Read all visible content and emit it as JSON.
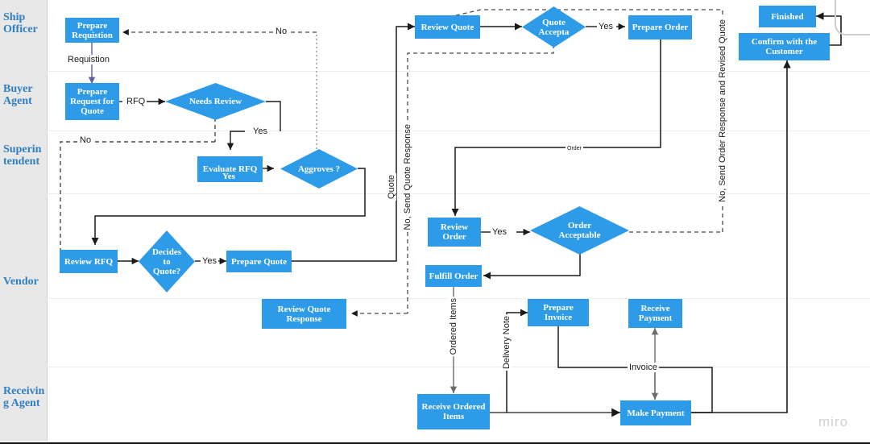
{
  "board": {
    "watermark": "miro"
  },
  "lanes": [
    {
      "id": "ship-officer",
      "label": "Ship Officer"
    },
    {
      "id": "buyer-agent",
      "label": "Buyer Agent"
    },
    {
      "id": "superintendent",
      "label": "Superintendent"
    },
    {
      "id": "vendor",
      "label": "Vendor"
    },
    {
      "id": "receiving-agent",
      "label": "Receiving Agent"
    }
  ],
  "nodes": [
    {
      "id": "prepare-requisition",
      "label": "Prepare Requistion",
      "shape": "box"
    },
    {
      "id": "prepare-request-quote",
      "label": "Prepare Request for Quote",
      "shape": "box"
    },
    {
      "id": "needs-review",
      "label": "Needs Review",
      "shape": "diamond"
    },
    {
      "id": "evaluate-rfq",
      "label": "Evaluate RFQ",
      "shape": "box"
    },
    {
      "id": "approves",
      "label": "Aggroves ?",
      "shape": "diamond"
    },
    {
      "id": "review-rfq",
      "label": "Review RFQ",
      "shape": "box"
    },
    {
      "id": "decides-to-quote",
      "label": "Decides to Quote?",
      "shape": "diamond"
    },
    {
      "id": "prepare-quote",
      "label": "Prepare Quote",
      "shape": "box"
    },
    {
      "id": "review-quote-response",
      "label": "Review Quote Response",
      "shape": "box"
    },
    {
      "id": "review-quote",
      "label": "Review Quote",
      "shape": "box"
    },
    {
      "id": "quote-accepted",
      "label": "Quote Accepta",
      "shape": "diamond"
    },
    {
      "id": "prepare-order",
      "label": "Prepare Order",
      "shape": "box"
    },
    {
      "id": "review-order",
      "label": "Review Order",
      "shape": "box"
    },
    {
      "id": "order-acceptable",
      "label": "Order Acceptable",
      "shape": "diamond"
    },
    {
      "id": "fulfill-order",
      "label": "Fulfill Order",
      "shape": "box"
    },
    {
      "id": "receive-ordered-items",
      "label": "Receive Ordered Items",
      "shape": "box"
    },
    {
      "id": "prepare-invoice",
      "label": "Prepare Invoice",
      "shape": "box"
    },
    {
      "id": "receive-payment",
      "label": "Receive Payment",
      "shape": "box"
    },
    {
      "id": "make-payment",
      "label": "Make Payment",
      "shape": "box"
    },
    {
      "id": "finished",
      "label": "Finished",
      "shape": "box"
    },
    {
      "id": "confirm-with-customer",
      "label": "Confirm with the Customer",
      "shape": "box"
    }
  ],
  "edge_labels": {
    "requisition": "Requistion",
    "rfq": "RFQ",
    "needs_review_no": "No",
    "needs_review_yes": "Yes",
    "evaluate_rfq_yes": "Yes",
    "approves_no": "No",
    "decides_yes": "Yes",
    "quote_accepted_yes": "Yes",
    "review_order_yes": "Yes",
    "order": "Order",
    "quote": "Quote",
    "no_send_quote_response": "No, Send Quote Response",
    "no_send_order_response": "No, Send Order Response and Revised Quote",
    "ordered_items": "Ordered Items",
    "delivery_note": "Delivery Note",
    "invoice": "Invoice"
  },
  "colors": {
    "node_fill": "#2e9be8",
    "node_text": "#ffffff",
    "lane_bg": "#e8e8e8",
    "lane_text": "#2f7fc1",
    "wire": "#1a1a1a",
    "canvas": "#ffffff"
  }
}
